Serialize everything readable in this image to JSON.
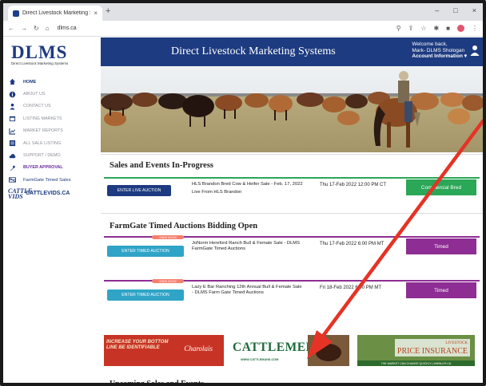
{
  "browser": {
    "tab_title": "Direct Livestock Marketing Syst...",
    "tab_close": "×",
    "new_tab": "+",
    "url": "dlms.ca",
    "window_controls": [
      "–",
      "□",
      "×"
    ]
  },
  "sidebar": {
    "logo_text": "DLMS",
    "logo_sub": "Direct Livestock Marketing Systems",
    "items": [
      {
        "label": "HOME",
        "icon": "home-icon"
      },
      {
        "label": "ABOUT US",
        "icon": "info-icon"
      },
      {
        "label": "CONTACT US",
        "icon": "person-icon"
      },
      {
        "label": "LISTING MARKETS",
        "icon": "calendar-icon"
      },
      {
        "label": "MARKET REPORTS",
        "icon": "chart-icon"
      },
      {
        "label": "ALL SALE LISTING",
        "icon": "list-icon"
      },
      {
        "label": "SUPPORT / DEMO",
        "icon": "cloud-icon"
      },
      {
        "label": "BUYER APPROVAL",
        "icon": "wrench-icon"
      },
      {
        "label": "FarmGate Timed Sales",
        "icon": "farmgate-icon"
      },
      {
        "label": "CATTLEVIDS.CA",
        "icon": "cattlevids-logo",
        "logo_text": "Cattle Vids"
      }
    ]
  },
  "header": {
    "title": "Direct Livestock Marketing Systems",
    "welcome": "Welcome back,",
    "user": "Mark- DLMS Shologan",
    "account_info": "Account Information ▾"
  },
  "sections": {
    "in_progress_title": "Sales and Events In-Progress",
    "farmgate_title": "FarmGate Timed Auctions Bidding Open",
    "upcoming_title": "Upcoming Sales and Events"
  },
  "events": [
    {
      "button": "ENTER LIVE AUCTION",
      "name": "HLS Brandon Bred Cow & Heifer Sale - Feb. 17, 2022",
      "subtext": "Live From HLS Brandon",
      "date": "Thu 17-Feb 2022 12:00 PM CT",
      "type": "Commercial Bred",
      "badge": ""
    },
    {
      "button": "ENTER TIMED AUCTION",
      "name": "JoNorm Hereford Ranch Bull & Female Sale - DLMS FarmGate Timed Auctions",
      "subtext": "",
      "date": "Thu 17-Feb 2022 6:00 PM MT",
      "type": "Timed",
      "badge": "ENDS SOON"
    },
    {
      "button": "ENTER TIMED AUCTION",
      "name": "Lazy E Bar Ranching 12th Annual Bull & Female Sale - DLMS Farm Gate Timed Auctions",
      "subtext": "",
      "date": "Fri 18-Feb 2022 6:00 PM MT",
      "type": "Timed",
      "badge": "ENDS SOON"
    }
  ],
  "ads": {
    "ad1_text": "INCREASE YOUR BOTTOM LINE BE IDENTIFIABLE",
    "ad1_logo": "Charolais",
    "ad2_logo": "CATTLEMENS",
    "ad2_url": "WWW.CATTLEMANS.COM",
    "ad3_small": "LIVESTOCK",
    "ad3_big": "PRICE INSURANCE",
    "ad3_foot": "THE MARKET CAN CHANGE QUICKLY | WWW.LPI.CA"
  },
  "colors": {
    "header_blue": "#1d3b80",
    "live_green": "#2aa757",
    "timed_purple": "#8e2d93",
    "timed_button": "#2fa4c7",
    "annotation_arrow": "#e53325"
  }
}
